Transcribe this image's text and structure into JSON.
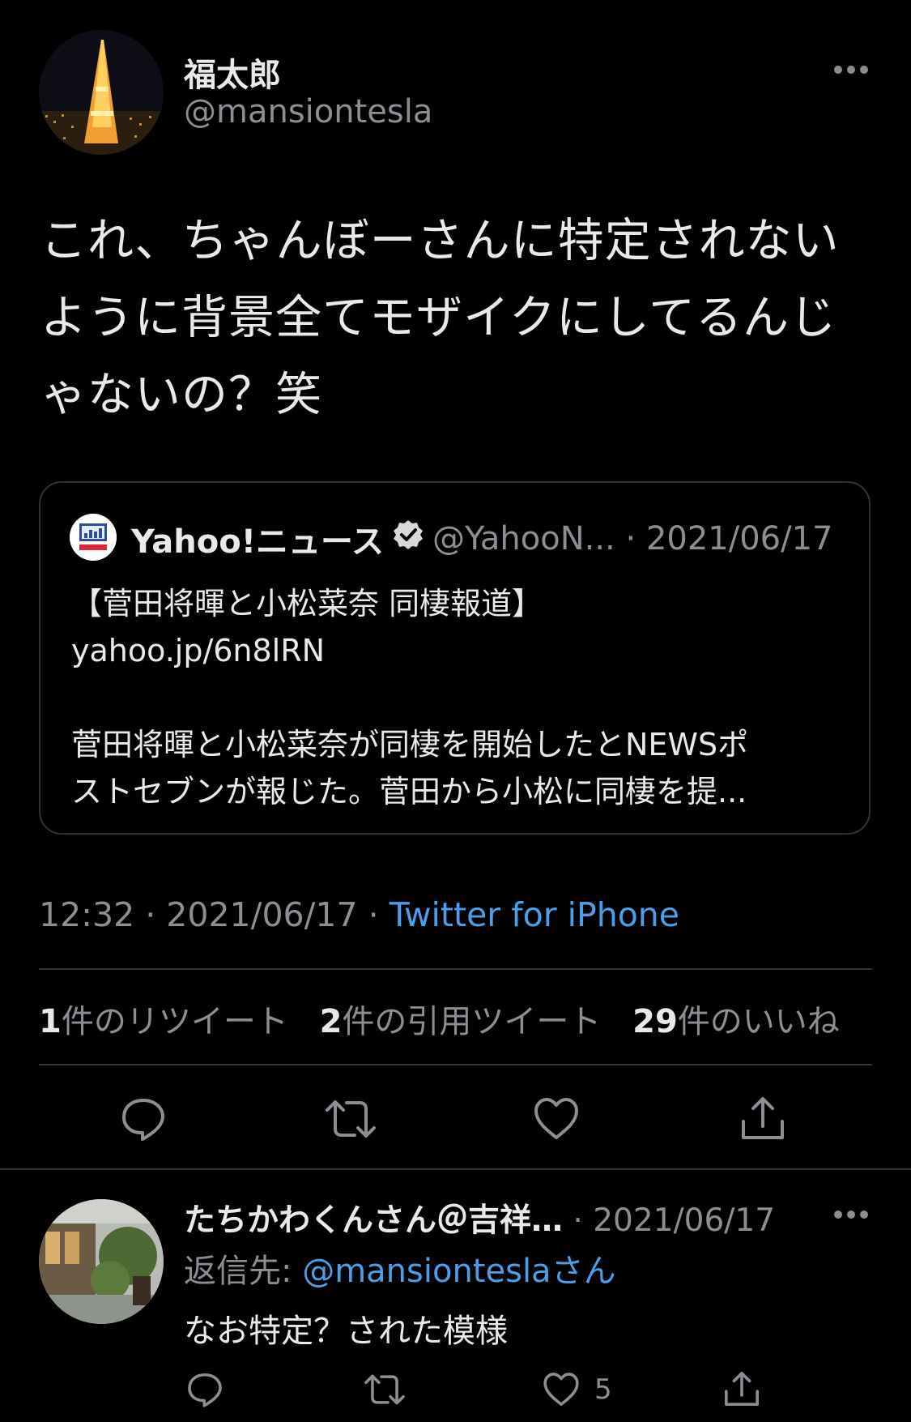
{
  "tweet": {
    "author": {
      "name": "福太郎",
      "handle": "@mansiontesla",
      "avatar": "tokyo-tower-night-avatar"
    },
    "text": "これ、ちゃんぼーさんに特定されないように背景全てモザイクにしてるんじゃないの？笑",
    "quoted": {
      "name": "Yahoo!ニュース",
      "verified": true,
      "handle": "@YahooN...",
      "separator": "·",
      "date": "2021/06/17",
      "body_lines": [
        "【菅田将暉と小松菜奈 同棲報道】",
        "yahoo.jp/6n8lRN",
        "",
        "菅田将暉と小松菜奈が同棲を開始したとNEWSポ",
        "ストセブンが報じた。菅田から小松に同棲を提..."
      ]
    },
    "meta": {
      "time": "12:32",
      "separator": "·",
      "date": "2021/06/17",
      "source": "Twitter for iPhone"
    },
    "stats": {
      "retweets_count": "1",
      "retweets_label": "件のリツイート",
      "quotes_count": "2",
      "quotes_label": "件の引用ツイート",
      "likes_count": "29",
      "likes_label": "件のいいね"
    },
    "actions": [
      "reply-icon",
      "retweet-icon",
      "like-icon",
      "share-icon"
    ]
  },
  "reply": {
    "name": "たちかわくんさん＠吉祥…",
    "separator": "·",
    "date": "2021/06/17",
    "reply_to_prefix": "返信先: ",
    "reply_to_handle": "@mansiontesla",
    "reply_to_suffix": "さん",
    "text": "なお特定？された模様",
    "like_count": "5"
  },
  "colors": {
    "background": "#000000",
    "text": "#e7e9ea",
    "muted": "#8b8f94",
    "link": "#4b9fe8",
    "border": "#2f3336"
  }
}
